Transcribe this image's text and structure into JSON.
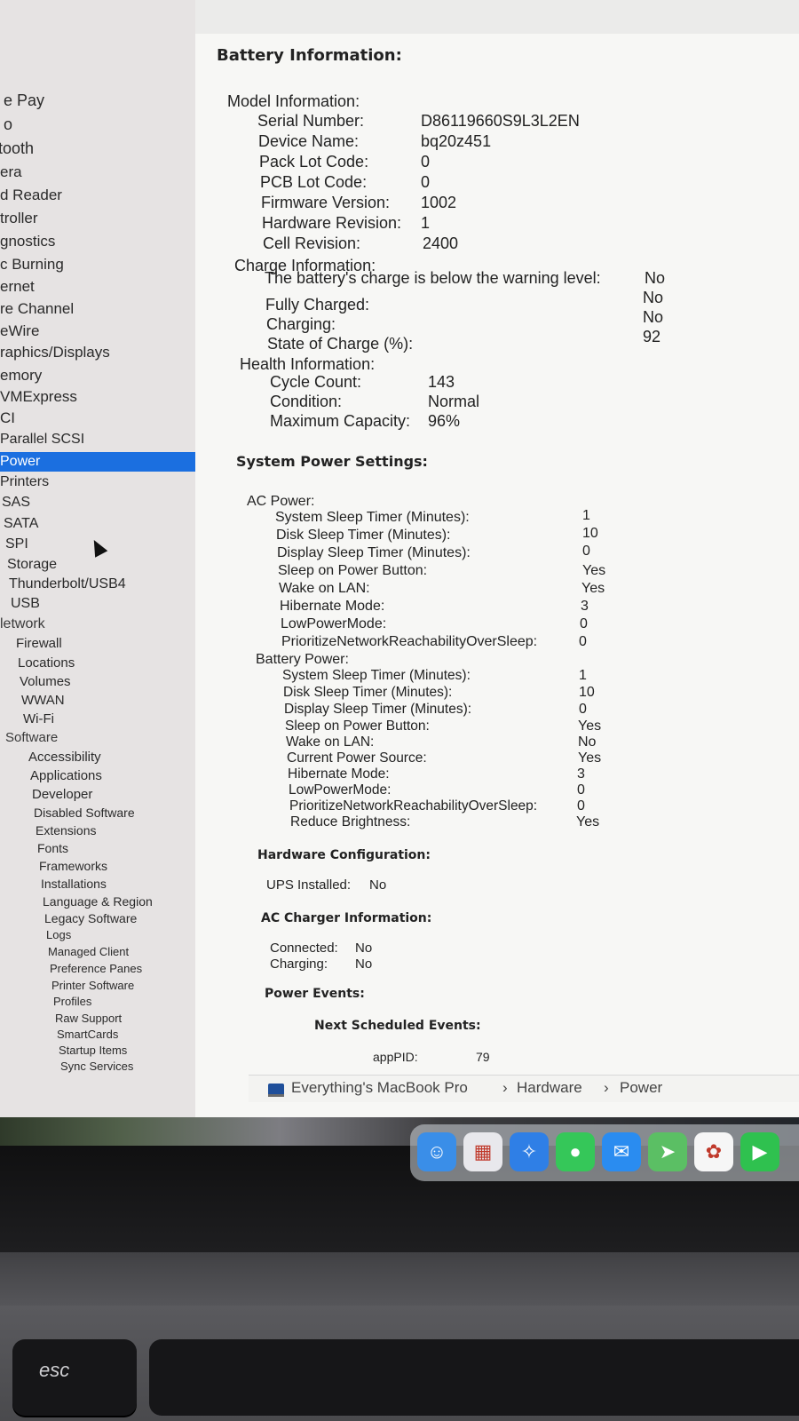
{
  "sidebar": {
    "items": [
      {
        "label": "e Pay"
      },
      {
        "label": "o"
      },
      {
        "label": "tooth"
      },
      {
        "label": "era"
      },
      {
        "label": "d Reader"
      },
      {
        "label": "troller"
      },
      {
        "label": "gnostics"
      },
      {
        "label": "c Burning"
      },
      {
        "label": "ernet"
      },
      {
        "label": "re Channel"
      },
      {
        "label": "eWire"
      },
      {
        "label": "raphics/Displays"
      },
      {
        "label": "emory"
      },
      {
        "label": "VMExpress"
      },
      {
        "label": "CI"
      },
      {
        "label": "Parallel SCSI"
      },
      {
        "label": "Power"
      },
      {
        "label": "Printers"
      },
      {
        "label": "SAS"
      },
      {
        "label": "SATA"
      },
      {
        "label": "SPI"
      },
      {
        "label": "Storage"
      },
      {
        "label": "Thunderbolt/USB4"
      },
      {
        "label": "USB"
      },
      {
        "label": "letwork"
      },
      {
        "label": "Firewall"
      },
      {
        "label": "Locations"
      },
      {
        "label": "Volumes"
      },
      {
        "label": "WWAN"
      },
      {
        "label": "Wi-Fi"
      },
      {
        "label": "Software"
      },
      {
        "label": "Accessibility"
      },
      {
        "label": "Applications"
      },
      {
        "label": "Developer"
      },
      {
        "label": "Disabled Software"
      },
      {
        "label": "Extensions"
      },
      {
        "label": "Fonts"
      },
      {
        "label": "Frameworks"
      },
      {
        "label": "Installations"
      },
      {
        "label": "Language & Region"
      },
      {
        "label": "Legacy Software"
      },
      {
        "label": "Logs"
      },
      {
        "label": "Managed Client"
      },
      {
        "label": "Preference Panes"
      },
      {
        "label": "Printer Software"
      },
      {
        "label": "Profiles"
      },
      {
        "label": "Raw Support"
      },
      {
        "label": "SmartCards"
      },
      {
        "label": "Startup Items"
      },
      {
        "label": "Sync Services"
      }
    ],
    "selected_color": "#1b6fe0"
  },
  "battery": {
    "heading": "Battery Information:",
    "model_heading": "Model Information:",
    "model": [
      {
        "k": "Serial Number:",
        "v": "D86119660S9L3L2EN"
      },
      {
        "k": "Device Name:",
        "v": "bq20z451"
      },
      {
        "k": "Pack Lot Code:",
        "v": "0"
      },
      {
        "k": "PCB Lot Code:",
        "v": "0"
      },
      {
        "k": "Firmware Version:",
        "v": "1002"
      },
      {
        "k": "Hardware Revision:",
        "v": "1"
      },
      {
        "k": "Cell Revision:",
        "v": "2400"
      }
    ],
    "charge_heading": "Charge Information:",
    "charge": [
      {
        "k": "The battery's charge is below the warning level:",
        "v": "No"
      },
      {
        "k": "Fully Charged:",
        "v": "No"
      },
      {
        "k": "Charging:",
        "v": "No"
      },
      {
        "k": "State of Charge (%):",
        "v": "92"
      }
    ],
    "health_heading": "Health Information:",
    "health": [
      {
        "k": "Cycle Count:",
        "v": "143"
      },
      {
        "k": "Condition:",
        "v": "Normal"
      },
      {
        "k": "Maximum Capacity:",
        "v": "96%"
      }
    ]
  },
  "power": {
    "heading": "System Power Settings:",
    "ac_heading": "AC Power:",
    "ac": [
      {
        "k": "System Sleep Timer (Minutes):",
        "v": "1"
      },
      {
        "k": "Disk Sleep Timer (Minutes):",
        "v": "10"
      },
      {
        "k": "Display Sleep Timer (Minutes):",
        "v": "0"
      },
      {
        "k": "Sleep on Power Button:",
        "v": "Yes"
      },
      {
        "k": "Wake on LAN:",
        "v": "Yes"
      },
      {
        "k": "Hibernate Mode:",
        "v": "3"
      },
      {
        "k": "LowPowerMode:",
        "v": "0"
      },
      {
        "k": "PrioritizeNetworkReachabilityOverSleep:",
        "v": "0"
      }
    ],
    "battery_heading": "Battery Power:",
    "battery": [
      {
        "k": "System Sleep Timer (Minutes):",
        "v": "1"
      },
      {
        "k": "Disk Sleep Timer (Minutes):",
        "v": "10"
      },
      {
        "k": "Display Sleep Timer (Minutes):",
        "v": "0"
      },
      {
        "k": "Sleep on Power Button:",
        "v": "Yes"
      },
      {
        "k": "Wake on LAN:",
        "v": "No"
      },
      {
        "k": "Current Power Source:",
        "v": "Yes"
      },
      {
        "k": "Hibernate Mode:",
        "v": "3"
      },
      {
        "k": "LowPowerMode:",
        "v": "0"
      },
      {
        "k": "PrioritizeNetworkReachabilityOverSleep:",
        "v": "0"
      },
      {
        "k": "Reduce Brightness:",
        "v": "Yes"
      }
    ]
  },
  "hardware": {
    "heading": "Hardware Configuration:",
    "ups_label": "UPS Installed:",
    "ups_value": "No"
  },
  "ac_charger": {
    "heading": "AC Charger Information:",
    "connected_label": "Connected:",
    "connected_value": "No",
    "charging_label": "Charging:",
    "charging_value": "No"
  },
  "power_events": {
    "heading": "Power Events:",
    "next_heading": "Next Scheduled Events:",
    "apppid_label": "appPID:",
    "apppid_value": "79"
  },
  "statusbar": {
    "path": [
      "Everything's MacBook Pro",
      "Hardware",
      "Power"
    ],
    "separator": "›"
  },
  "dock": {
    "apps": [
      {
        "name": "finder-icon",
        "color": "#3a8ee8",
        "glyph": "☺"
      },
      {
        "name": "launchpad-icon",
        "color": "#e8e8ec",
        "glyph": "▦"
      },
      {
        "name": "safari-icon",
        "color": "#2f7fe6",
        "glyph": "✧"
      },
      {
        "name": "messages-icon",
        "color": "#35c759",
        "glyph": "●"
      },
      {
        "name": "mail-icon",
        "color": "#2a8cf0",
        "glyph": "✉"
      },
      {
        "name": "maps-icon",
        "color": "#5bbf64",
        "glyph": "➤"
      },
      {
        "name": "photos-icon",
        "color": "#f6f6f6",
        "glyph": "✿"
      },
      {
        "name": "facetime-icon",
        "color": "#2fc14f",
        "glyph": "▶"
      }
    ]
  },
  "keyboard": {
    "esc_label": "esc"
  }
}
